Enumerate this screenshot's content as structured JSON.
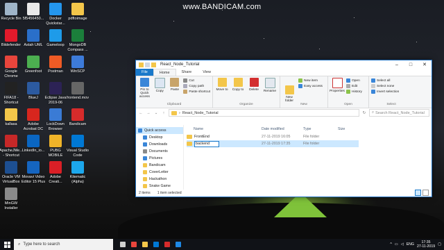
{
  "watermark": "www.BANDICAM.com",
  "desktop_icons": [
    {
      "label": "Recycle Bin",
      "color": "#9fb4c8"
    },
    {
      "label": "5f5456450...",
      "color": "#e9e9e9"
    },
    {
      "label": "Docker Quickstar...",
      "color": "#2496ed"
    },
    {
      "label": "pdftoimage",
      "color": "#f3c64a"
    },
    {
      "label": "Bitdefender",
      "color": "#e11a2b"
    },
    {
      "label": "Astah UML",
      "color": "#2a6fc9"
    },
    {
      "label": "Gameloop",
      "color": "#1e9be9"
    },
    {
      "label": "MongoDB Compass ...",
      "color": "#1b7f3b"
    },
    {
      "label": "Google Chrome",
      "color": "#e8453c"
    },
    {
      "label": "Greenfoot",
      "color": "#4caf50"
    },
    {
      "label": "Postman",
      "color": "#ef5b25"
    },
    {
      "label": "WinSCP",
      "color": "#3d7bd9"
    },
    {
      "label": "FIFA18 - Shortcut",
      "color": "#222222"
    },
    {
      "label": "BlueJ",
      "color": "#2c5aa0"
    },
    {
      "label": "Eclipse Java 2019-06",
      "color": "#2c2255"
    },
    {
      "label": "frontend.mov",
      "color": "#666666"
    },
    {
      "label": "kallasa",
      "color": "#f3c64a"
    },
    {
      "label": "Adobe Acrobat DC",
      "color": "#d7261e"
    },
    {
      "label": "LockDown Browser",
      "color": "#3a7bd5"
    },
    {
      "label": "Bandicam",
      "color": "#d62b2b"
    },
    {
      "label": "ApacheJMe... - Shortcut",
      "color": "#c62828"
    },
    {
      "label": "LinkedIn_io...",
      "color": "#0a66c2"
    },
    {
      "label": "PUBG MOBILE",
      "color": "#f0b429"
    },
    {
      "label": "Visual Studio Code",
      "color": "#0078d4"
    },
    {
      "label": "Oracle VM VirtualBox",
      "color": "#1d4f91"
    },
    {
      "label": "Movavi Video Editor 15 Plus",
      "color": "#1565c0"
    },
    {
      "label": "Adobe Creati...",
      "color": "#da1f26"
    },
    {
      "label": "Kitematic (Alpha)",
      "color": "#1ca7ec"
    },
    {
      "label": "MinGW Installer",
      "color": "#8a8a8a"
    }
  ],
  "explorer": {
    "title": "React_Node_Tutorial",
    "tabs": [
      "File",
      "Home",
      "Share",
      "View"
    ],
    "active_tab": "Home",
    "ribbon": {
      "clipboard": {
        "caption": "Clipboard",
        "pin": "Pin to Quick access",
        "copy": "Copy",
        "paste": "Paste",
        "cut": "Cut",
        "copy_path": "Copy path",
        "paste_shortcut": "Paste shortcut"
      },
      "organize": {
        "caption": "Organize",
        "move_to": "Move to",
        "copy_to": "Copy to",
        "delete": "Delete",
        "rename": "Rename"
      },
      "new": {
        "caption": "New",
        "new_item": "New item",
        "easy_access": "Easy access",
        "new_folder": "New folder"
      },
      "open": {
        "caption": "Open",
        "properties": "Properties",
        "open": "Open",
        "edit": "Edit",
        "history": "History"
      },
      "select": {
        "caption": "Select",
        "select_all": "Select all",
        "select_none": "Select none",
        "invert": "Invert selection"
      }
    },
    "address": {
      "path": "React_Node_Tutorial",
      "search_placeholder": "Search React_Node_Tutorial"
    },
    "nav": [
      {
        "label": "Quick access",
        "color": "#3a86d8"
      },
      {
        "label": "Desktop",
        "color": "#3a86d8"
      },
      {
        "label": "Downloads",
        "color": "#3a86d8"
      },
      {
        "label": "Documents",
        "color": "#8a8a8a"
      },
      {
        "label": "Pictures",
        "color": "#3a86d8"
      },
      {
        "label": "Bandicam",
        "color": "#f3c64a"
      },
      {
        "label": "CoverLetter",
        "color": "#f3c64a"
      },
      {
        "label": "Hackathon",
        "color": "#f3c64a"
      },
      {
        "label": "Snake Game",
        "color": "#f3c64a"
      },
      {
        "label": "Creative Cloud File",
        "color": "#da1f26"
      }
    ],
    "columns": {
      "name": "Name",
      "date": "Date modified",
      "type": "Type",
      "size": "Size"
    },
    "files": [
      {
        "name": "FrontEnd",
        "date": "27-11-2019 16:05",
        "type": "File folder"
      },
      {
        "name": "backend",
        "date": "27-11-2019 17:35",
        "type": "File folder"
      }
    ],
    "status": {
      "items": "2 items",
      "selected": "1 item selected"
    }
  },
  "taskbar": {
    "search_placeholder": "Type here to search",
    "apps": [
      {
        "name": "task-view",
        "color": "#cfcfcf"
      },
      {
        "name": "chrome",
        "color": "#e8453c"
      },
      {
        "name": "file-explorer",
        "color": "#f3c64a"
      },
      {
        "name": "vscode",
        "color": "#0078d4"
      },
      {
        "name": "bandicam-app",
        "color": "#d62b2b"
      },
      {
        "name": "media",
        "color": "#1e88e5"
      }
    ],
    "lang": "ENG",
    "time": "17:35",
    "date": "27-11-2019"
  }
}
